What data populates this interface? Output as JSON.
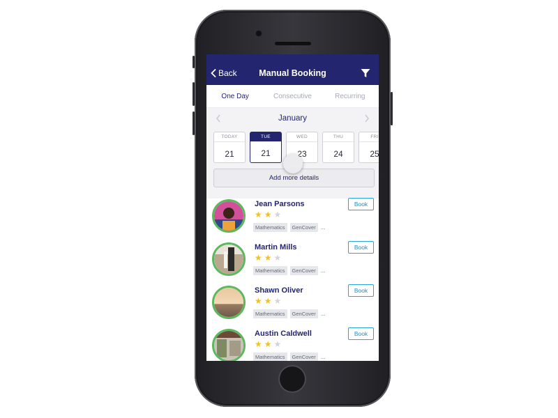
{
  "nav": {
    "back_label": "Back",
    "title": "Manual Booking",
    "filter_icon": "filter-icon"
  },
  "tabs": [
    {
      "label": "One Day",
      "active": true
    },
    {
      "label": "Consecutive",
      "active": false
    },
    {
      "label": "Recurring",
      "active": false
    }
  ],
  "calendar": {
    "month": "January",
    "days": [
      {
        "name": "TODAY",
        "num": "21",
        "selected": false
      },
      {
        "name": "TUE",
        "num": "21",
        "selected": true
      },
      {
        "name": "WED",
        "num": "23",
        "selected": false
      },
      {
        "name": "THU",
        "num": "24",
        "selected": false
      },
      {
        "name": "FRI",
        "num": "25",
        "selected": false
      }
    ],
    "add_details_label": "Add more details"
  },
  "tutors": [
    {
      "name": "Jean Parsons",
      "rating": 2,
      "max_rating": 3,
      "tags": [
        "Mathematics",
        "GenCover"
      ],
      "more": "...",
      "book_label": "Book"
    },
    {
      "name": "Martin Mills",
      "rating": 2,
      "max_rating": 3,
      "tags": [
        "Mathematics",
        "GenCover"
      ],
      "more": "...",
      "book_label": "Book"
    },
    {
      "name": "Shawn Oliver",
      "rating": 2,
      "max_rating": 3,
      "tags": [
        "Mathematics",
        "GenCover"
      ],
      "more": "...",
      "book_label": "Book"
    },
    {
      "name": "Austin Caldwell",
      "rating": 2,
      "max_rating": 3,
      "tags": [
        "Mathematics",
        "GenCover"
      ],
      "more": "...",
      "book_label": "Book"
    }
  ],
  "colors": {
    "brand_navy": "#23256e",
    "avatar_ring": "#5cb85c",
    "star_on": "#f4c21e",
    "star_off": "#d3d4d9",
    "book_accent": "#2aa6d6"
  }
}
